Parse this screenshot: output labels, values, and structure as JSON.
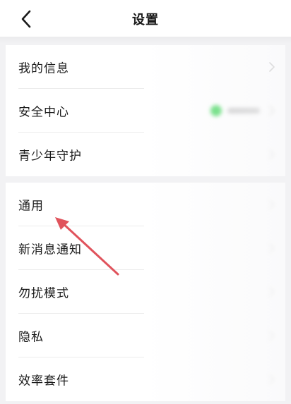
{
  "header": {
    "title": "设置",
    "back_icon": "chevron-left-icon"
  },
  "groups": [
    {
      "items": [
        {
          "label": "我的信息"
        },
        {
          "label": "安全中心",
          "status_color": "#4cd964"
        },
        {
          "label": "青少年守护"
        }
      ]
    },
    {
      "items": [
        {
          "label": "通用"
        },
        {
          "label": "新消息通知"
        },
        {
          "label": "勿扰模式"
        },
        {
          "label": "隐私"
        },
        {
          "label": "效率套件"
        }
      ]
    }
  ],
  "colors": {
    "background": "#f2f2f4",
    "row": "#ffffff",
    "annotation_arrow": "#e0535c",
    "chevron": "#c4c4c4"
  }
}
